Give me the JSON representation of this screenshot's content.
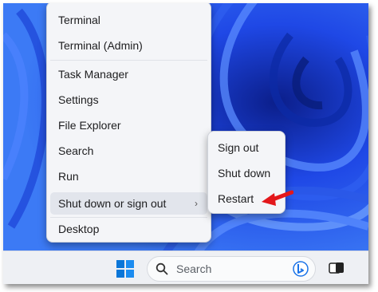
{
  "context_menu": {
    "items": [
      {
        "label": "Terminal"
      },
      {
        "label": "Terminal (Admin)"
      },
      {
        "label": "Task Manager"
      },
      {
        "label": "Settings"
      },
      {
        "label": "File Explorer"
      },
      {
        "label": "Search"
      },
      {
        "label": "Run"
      },
      {
        "label": "Shut down or sign out"
      },
      {
        "label": "Desktop"
      }
    ],
    "chevron": "›"
  },
  "submenu": {
    "items": [
      {
        "label": "Sign out"
      },
      {
        "label": "Shut down"
      },
      {
        "label": "Restart"
      }
    ]
  },
  "taskbar": {
    "search_placeholder": "Search",
    "icons": [
      "windows-start-icon",
      "search-icon",
      "bing-icon",
      "task-view-icon"
    ]
  },
  "annotation": {
    "arrow_color": "#e3171b",
    "points_to": "Restart"
  },
  "colors": {
    "wallpaper": "#1a3ad8",
    "menu_bg": "#f4f5f8",
    "taskbar_bg": "#eef0f4",
    "accent": "#0078d4"
  }
}
